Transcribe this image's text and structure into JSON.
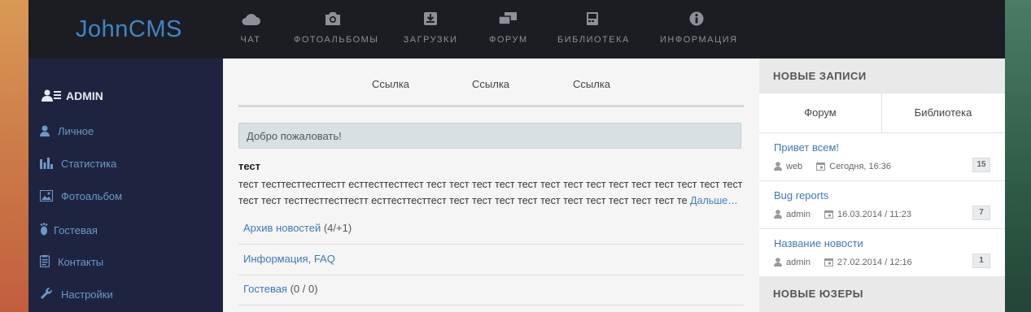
{
  "header": {
    "logo": "JohnCMS",
    "nav": [
      {
        "label": "ЧАТ",
        "icon": "cloud-icon"
      },
      {
        "label": "ФОТОАЛЬБОМЫ",
        "icon": "camera-icon"
      },
      {
        "label": "ЗАГРУЗКИ",
        "icon": "download-icon"
      },
      {
        "label": "ФОРУМ",
        "icon": "chat-bubbles-icon"
      },
      {
        "label": "БИБЛИОТЕКА",
        "icon": "book-icon"
      },
      {
        "label": "ИНФОРМАЦИЯ",
        "icon": "info-icon"
      }
    ]
  },
  "sidebar": {
    "user": "ADMIN",
    "items": [
      {
        "label": "Личное",
        "icon": "user-icon"
      },
      {
        "label": "Статистика",
        "icon": "bar-chart-icon"
      },
      {
        "label": "Фотоальбом",
        "icon": "picture-icon"
      },
      {
        "label": "Гостевая",
        "icon": "footprint-icon"
      },
      {
        "label": "Контакты",
        "icon": "contacts-icon"
      },
      {
        "label": "Настройки",
        "icon": "wrench-icon"
      }
    ]
  },
  "main": {
    "links": [
      "Ссылка",
      "Ссылка",
      "Ссылка"
    ],
    "welcome": "Добро пожаловать!",
    "news": {
      "title": "тест",
      "line1": "тест тесттесттесттестт ecттесттесттест тест тест тест тест тест тест тест тест тест тест тест тест тест тест",
      "line2": "тест тест тесттесттесттестт ecттесттесттест тест тест тест тест тест тест тест тест тест тест те",
      "more": "Дальше…"
    },
    "rows": [
      {
        "title": "Архив новостей",
        "open": " (4/",
        "count": "+1",
        "close": ")"
      },
      {
        "title": "Информация, FAQ"
      },
      {
        "title": "Гостевая",
        "open": " (0 / ",
        "count": "0",
        "close": ")"
      }
    ]
  },
  "right": {
    "new_posts_title": "НОВЫЕ ЗАПИСИ",
    "tabs": [
      "Форум",
      "Библиотека"
    ],
    "posts": [
      {
        "title": "Привет всем!",
        "author": "web",
        "date": "Сегодня, 16:36",
        "count": "15"
      },
      {
        "title": "Bug reports",
        "author": "admin",
        "date": "16.03.2014 / 11:23",
        "count": "7"
      },
      {
        "title": "Название новости",
        "author": "admin",
        "date": "27.02.2014 / 12:16",
        "count": "1"
      }
    ],
    "new_users_title": "НОВЫЕ ЮЗЕРЫ"
  },
  "colors": {
    "accent": "#3f86c6",
    "link": "#3b79bd",
    "sidebar": "#1e2440",
    "alert": "#d02a2a"
  }
}
